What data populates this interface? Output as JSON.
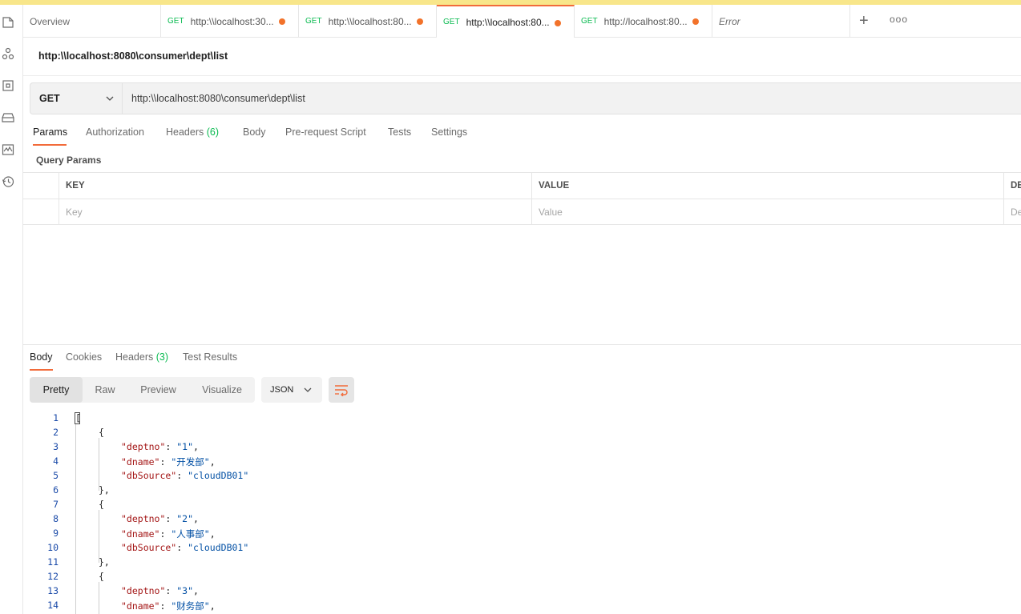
{
  "tabs": [
    {
      "type": "overview",
      "label": "Overview"
    },
    {
      "method": "GET",
      "label": "http:\\\\localhost:30..."
    },
    {
      "method": "GET",
      "label": "http:\\\\localhost:80..."
    },
    {
      "method": "GET",
      "label": "http:\\\\localhost:80...",
      "active": true
    },
    {
      "method": "GET",
      "label": "http://localhost:80..."
    },
    {
      "type": "error",
      "label": "Error"
    }
  ],
  "tabbar": {
    "plus": "+",
    "more": "ooo"
  },
  "request": {
    "title": "http:\\\\localhost:8080\\consumer\\dept\\list",
    "method": "GET",
    "url": "http:\\\\localhost:8080\\consumer\\dept\\list"
  },
  "request_tabs": {
    "params": "Params",
    "authorization": "Authorization",
    "headers": "Headers",
    "headers_count": "(6)",
    "body": "Body",
    "prerequest": "Pre-request Script",
    "tests": "Tests",
    "settings": "Settings"
  },
  "query_params": {
    "label": "Query Params",
    "col_key": "KEY",
    "col_value": "VALUE",
    "col_desc": "DE",
    "ph_key": "Key",
    "ph_value": "Value",
    "ph_desc": "De"
  },
  "response_tabs": {
    "body": "Body",
    "cookies": "Cookies",
    "headers": "Headers",
    "headers_count": "(3)",
    "test_results": "Test Results"
  },
  "format": {
    "pretty": "Pretty",
    "raw": "Raw",
    "preview": "Preview",
    "visualize": "Visualize",
    "lang": "JSON"
  },
  "code": {
    "line_numbers": [
      "1",
      "2",
      "3",
      "4",
      "5",
      "6",
      "7",
      "8",
      "9",
      "10",
      "11",
      "12",
      "13",
      "14"
    ],
    "l1": "[",
    "l2": "{",
    "l3k": "\"deptno\"",
    "l3v": "\"1\"",
    "l4k": "\"dname\"",
    "l4v": "\"开发部\"",
    "l5k": "\"dbSource\"",
    "l5v": "\"cloudDB01\"",
    "l6": "},",
    "l7": "{",
    "l8k": "\"deptno\"",
    "l8v": "\"2\"",
    "l9k": "\"dname\"",
    "l9v": "\"人事部\"",
    "l10k": "\"dbSource\"",
    "l10v": "\"cloudDB01\"",
    "l11": "},",
    "l12": "{",
    "l13k": "\"deptno\"",
    "l13v": "\"3\"",
    "l14k": "\"dname\"",
    "l14v": "\"财务部\""
  },
  "colors": {
    "accent": "#f26b3a",
    "method_get": "#0cbb52",
    "dirty_dot": "#f2722a"
  }
}
